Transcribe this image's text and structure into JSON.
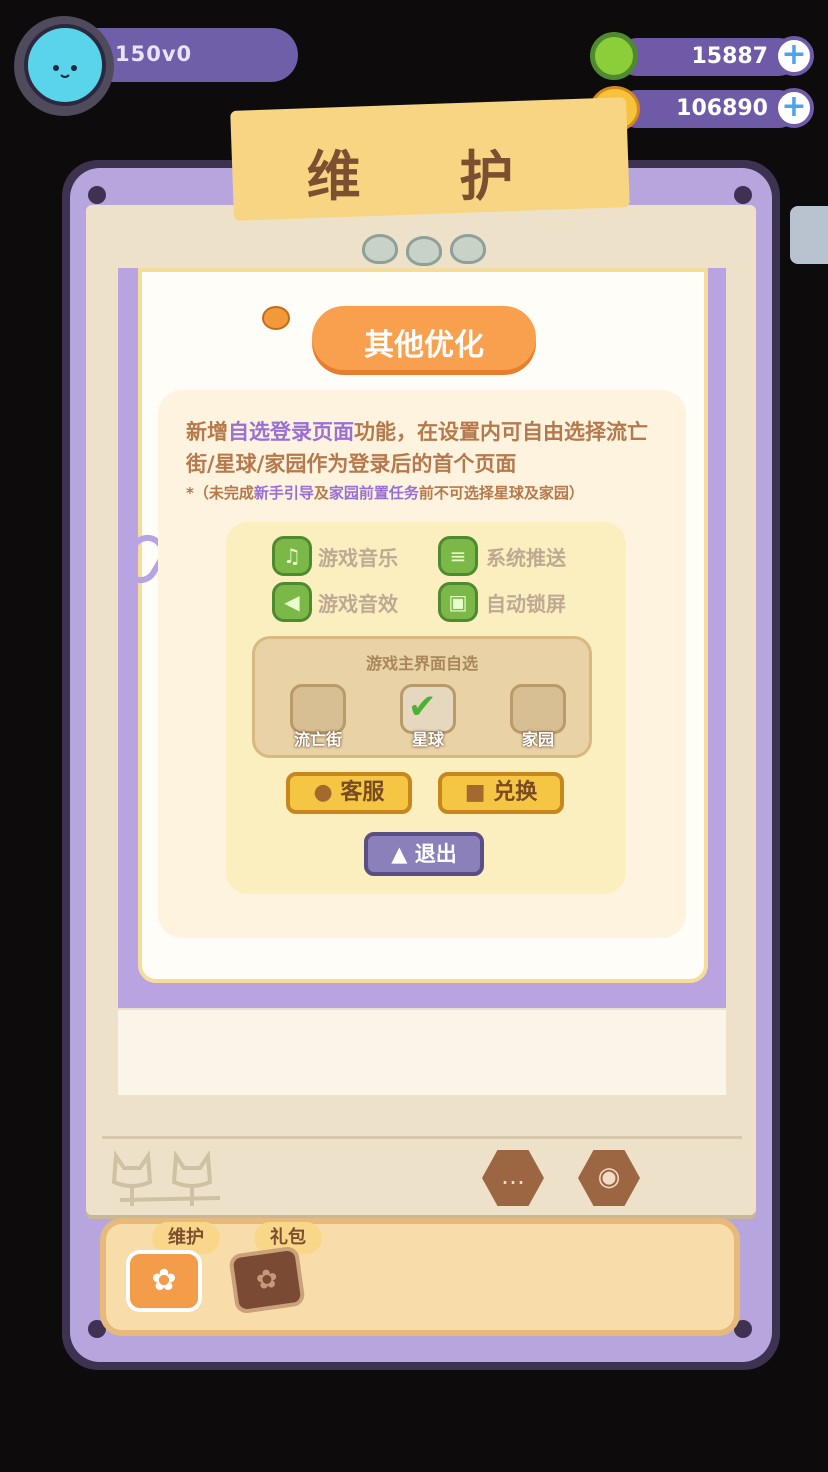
{
  "player": {
    "name": "150v0"
  },
  "currencies": [
    {
      "icon": "green-ring-currency-icon",
      "value": "15887"
    },
    {
      "icon": "golden-planet-currency-icon",
      "value": "106890"
    }
  ],
  "panel": {
    "title": "维 护"
  },
  "section": {
    "title": "其他优化",
    "desc_parts": [
      "新增",
      "自选登录页面",
      "功能，在设置内可自由选择流亡街/星球/家园作为登录后的首个页面"
    ],
    "note_parts": [
      "*（未完成",
      "新手引导",
      "及",
      "家园前置任务",
      "前不可选择星球及家园）"
    ]
  },
  "settings": {
    "options": [
      "游戏音乐",
      "系统推送",
      "游戏音效",
      "自动锁屏"
    ],
    "chooser_title": "游戏主界面自选",
    "choices": [
      "流亡街",
      "星球",
      "家园"
    ],
    "selected_choice": "星球",
    "service_button": "客服",
    "redeem_button": "兑换",
    "exit_button": "退出"
  },
  "tabs": [
    {
      "label": "维护",
      "icon": "cat-paw-wrench-icon"
    },
    {
      "label": "礼包",
      "icon": "gift-bag-icon"
    }
  ],
  "colors": {
    "accent_purple": "#6f5fa8",
    "paper": "#eee1c9",
    "orange": "#f9a04e",
    "gold": "#f5c544"
  }
}
